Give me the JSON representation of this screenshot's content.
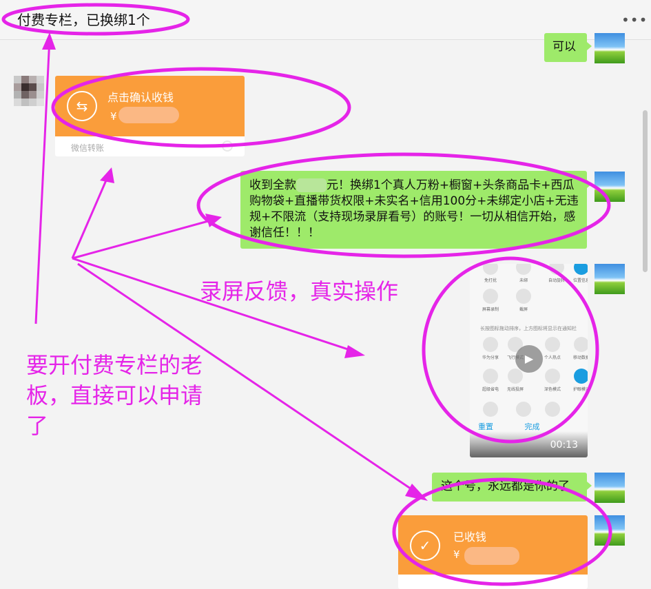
{
  "header": {
    "title": "付费专栏，已换绑1个",
    "more_icon": "more-dots-icon"
  },
  "messages": {
    "reply_ok": "可以",
    "incoming_transfer": {
      "label": "点击确认收钱",
      "currency": "¥",
      "footer": "微信转账",
      "icon": "transfer-arrows-icon"
    },
    "sent_text_parts": [
      "收到全款",
      "元！换绑1个真人万粉+橱窗+头条商品卡+西瓜购物袋+直播带货权限+未实名+信用100分+未绑定小店+无违规+不限流（支持现场录屏看号）的账号！一切从相信开始，感谢信任！！！"
    ],
    "video": {
      "duration": "00:13",
      "play_icon": "play-icon"
    },
    "sent_final": "这个号，永远都是你的了",
    "outgoing_transfer": {
      "label": "已收钱",
      "currency": "¥",
      "icon": "check-circle-icon"
    }
  },
  "annotations": {
    "note_screen": "录屏反馈，真实操作",
    "note_boss": "要开付费专栏的老板，直接可以申请了",
    "color": "#e524e8"
  },
  "colors": {
    "bubble_green": "#9eea6a",
    "transfer_orange": "#fa9d3b"
  }
}
